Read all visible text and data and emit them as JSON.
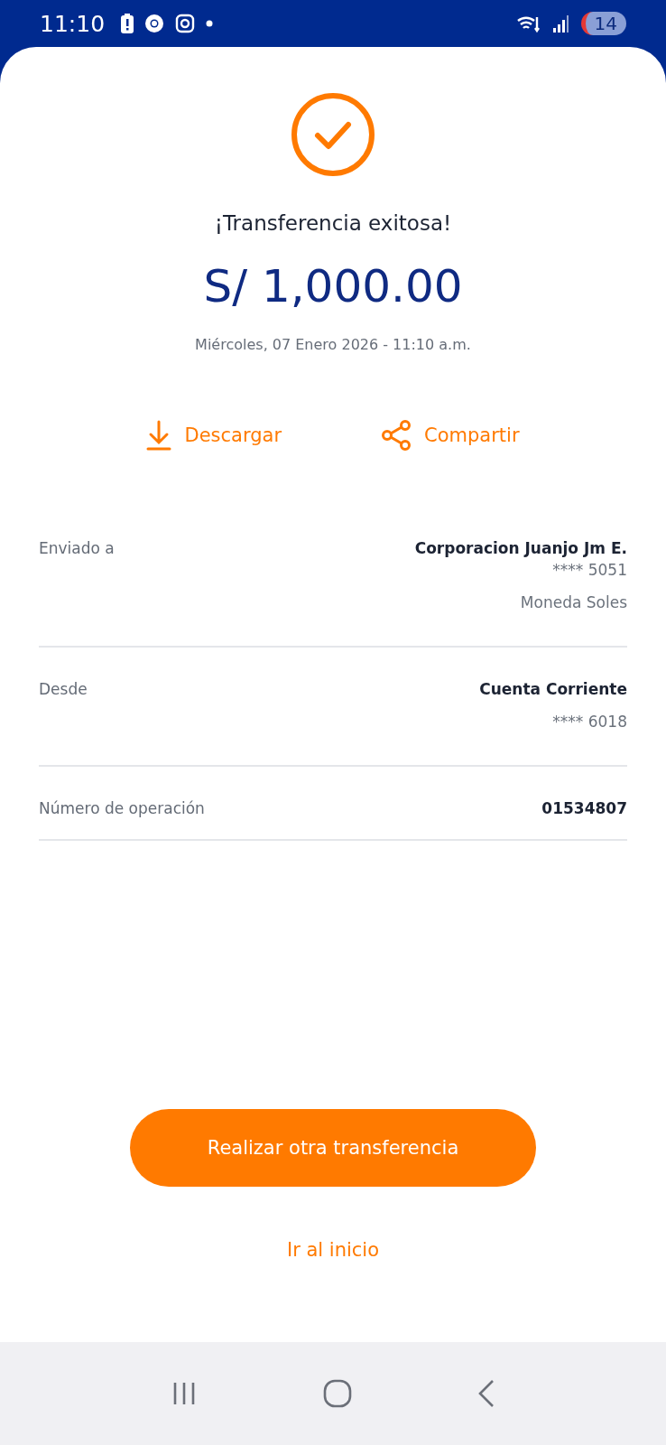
{
  "status_bar": {
    "time": "11:10",
    "battery": "14"
  },
  "result": {
    "title": "¡Transferencia exitosa!",
    "amount": "S/ 1,000.00",
    "date": "Miércoles, 07 Enero 2026 - 11:10 a.m."
  },
  "actions": [
    {
      "kind": "download",
      "label": "Descargar"
    },
    {
      "kind": "share",
      "label": "Compartir"
    }
  ],
  "details": [
    {
      "label": "Enviado a",
      "values": [
        {
          "kind": "main",
          "text": "Corporacion Juanjo Jm E."
        },
        {
          "kind": "sub",
          "text": "**** 5051"
        },
        {
          "kind": "extra",
          "text": "Moneda Soles"
        }
      ]
    },
    {
      "label": "Desde",
      "values": [
        {
          "kind": "main",
          "text": "Cuenta Corriente"
        },
        {
          "kind": "extra",
          "text": "**** 6018"
        }
      ]
    },
    {
      "label": "Número de operación",
      "values": [
        {
          "kind": "main",
          "text": "01534807"
        }
      ]
    }
  ],
  "primary_button": "Realizar otra transferencia",
  "secondary_link": "Ir al inicio"
}
